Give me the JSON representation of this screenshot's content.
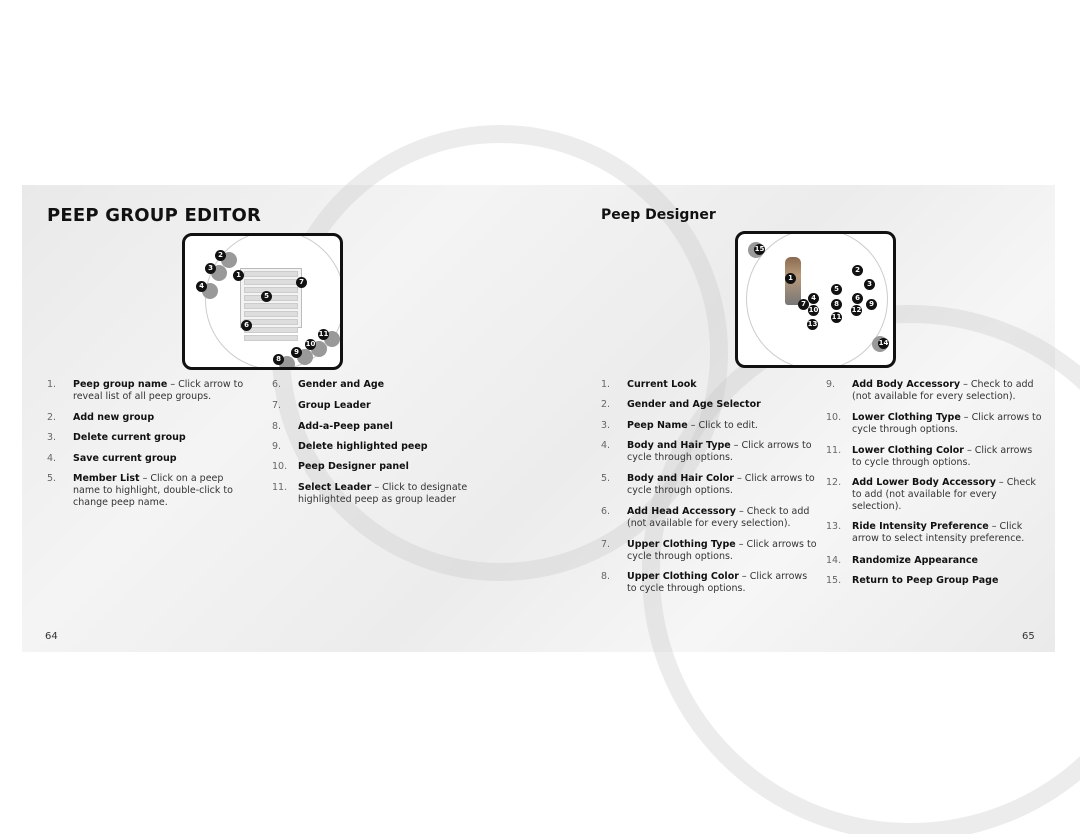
{
  "left_page": {
    "title": "PEEP GROUP EDITOR",
    "page_number": "64",
    "callouts": [
      "1",
      "2",
      "3",
      "4",
      "5",
      "6",
      "7",
      "8",
      "9",
      "10",
      "11"
    ],
    "items": [
      {
        "n": "1.",
        "label": "Peep group name",
        "desc": " – Click arrow to reveal list of all peep groups."
      },
      {
        "n": "2.",
        "label": "Add new group",
        "desc": ""
      },
      {
        "n": "3.",
        "label": "Delete current group",
        "desc": ""
      },
      {
        "n": "4.",
        "label": "Save current group",
        "desc": ""
      },
      {
        "n": "5.",
        "label": "Member List",
        "desc": " – Click on a peep name to highlight, double-click to change peep name."
      },
      {
        "n": "6.",
        "label": "Gender and Age",
        "desc": ""
      },
      {
        "n": "7.",
        "label": "Group Leader",
        "desc": ""
      },
      {
        "n": "8.",
        "label": "Add-a-Peep panel",
        "desc": ""
      },
      {
        "n": "9.",
        "label": "Delete highlighted peep",
        "desc": ""
      },
      {
        "n": "10.",
        "label": "Peep Designer panel",
        "desc": ""
      },
      {
        "n": "11.",
        "label": "Select Leader",
        "desc": " – Click to designate highlighted peep as group leader"
      }
    ]
  },
  "right_page": {
    "title": "Peep Designer",
    "page_number": "65",
    "callouts": [
      "1",
      "2",
      "3",
      "4",
      "5",
      "6",
      "7",
      "8",
      "9",
      "10",
      "11",
      "12",
      "13",
      "14",
      "15"
    ],
    "items": [
      {
        "n": "1.",
        "label": "Current Look",
        "desc": ""
      },
      {
        "n": "2.",
        "label": "Gender and Age Selector",
        "desc": ""
      },
      {
        "n": "3.",
        "label": "Peep Name",
        "desc": " – Click to edit."
      },
      {
        "n": "4.",
        "label": "Body and Hair Type",
        "desc": " – Click arrows to cycle through options."
      },
      {
        "n": "5.",
        "label": "Body and Hair Color",
        "desc": " – Click arrows to cycle through options."
      },
      {
        "n": "6.",
        "label": "Add Head Accessory",
        "desc": " – Check to add (not available for every selection)."
      },
      {
        "n": "7.",
        "label": "Upper Clothing Type",
        "desc": " – Click arrows to cycle through options."
      },
      {
        "n": "8.",
        "label": "Upper Clothing Color",
        "desc": " – Click arrows to cycle through options."
      },
      {
        "n": "9.",
        "label": "Add Body Accessory",
        "desc": " – Check to add (not available for every selection)."
      },
      {
        "n": "10.",
        "label": "Lower Clothing Type",
        "desc": " – Click arrows to cycle through options."
      },
      {
        "n": "11.",
        "label": "Lower Clothing Color",
        "desc": " – Click arrows to cycle through options."
      },
      {
        "n": "12.",
        "label": "Add Lower Body Accessory",
        "desc": " – Check to add (not available for every selection)."
      },
      {
        "n": "13.",
        "label": "Ride Intensity Preference",
        "desc": " – Click arrow to select intensity preference."
      },
      {
        "n": "14.",
        "label": "Randomize Appearance",
        "desc": ""
      },
      {
        "n": "15.",
        "label": "Return to Peep Group Page",
        "desc": ""
      }
    ]
  }
}
